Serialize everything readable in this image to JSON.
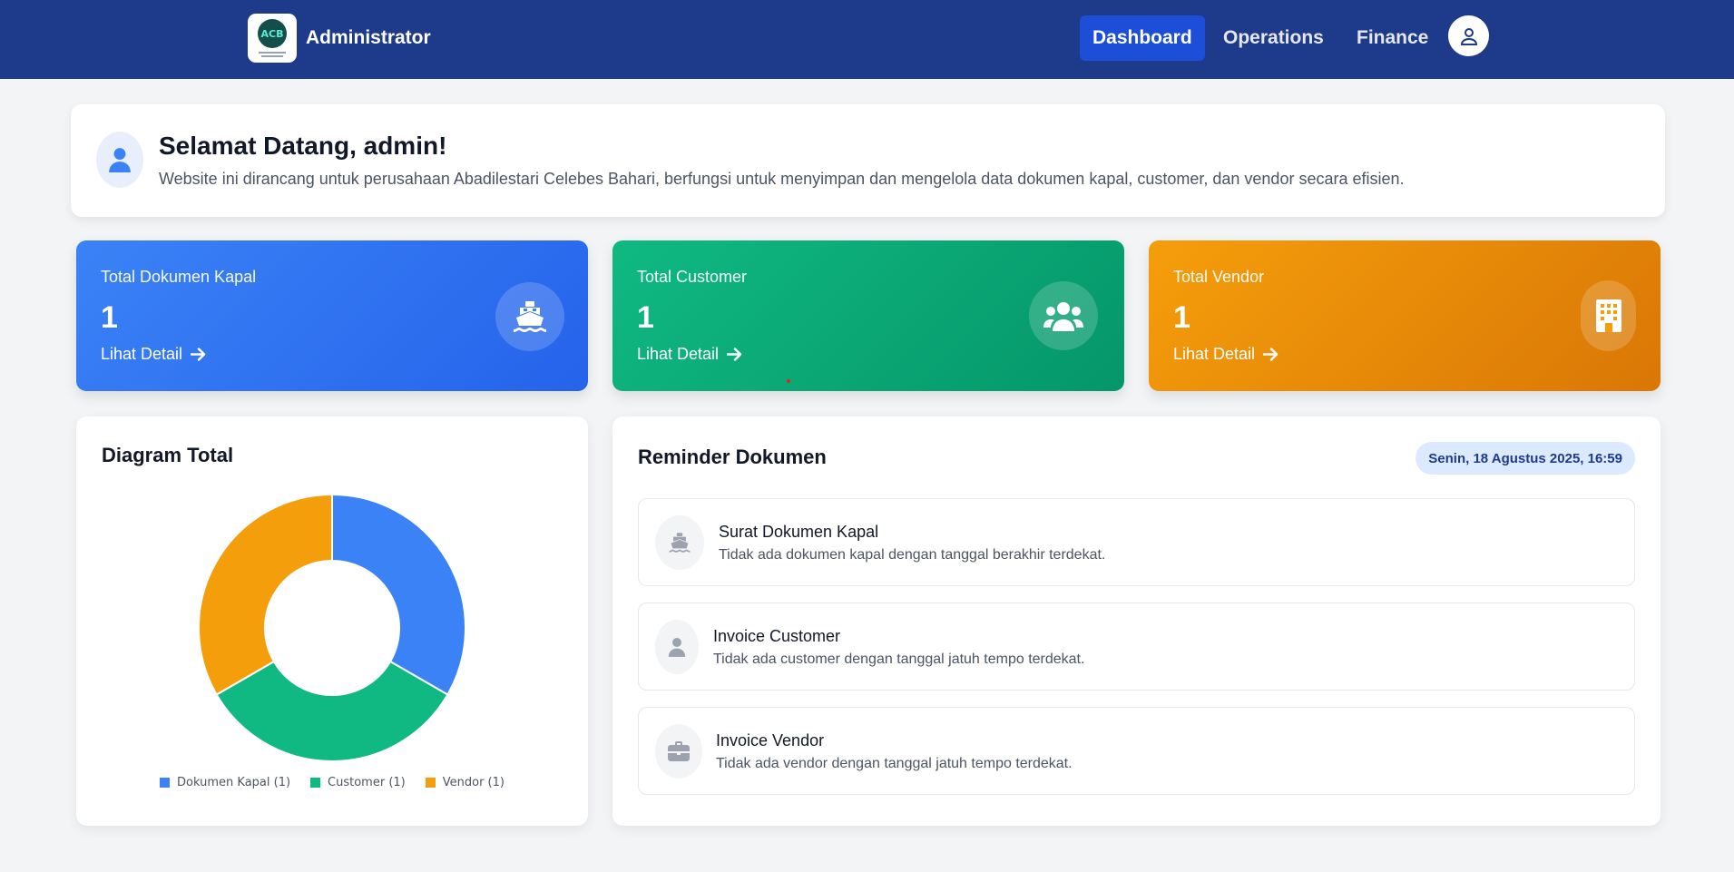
{
  "navbar": {
    "logo_text": "ACB",
    "brand": "Administrator",
    "items": [
      {
        "label": "Dashboard"
      },
      {
        "label": "Operations"
      },
      {
        "label": "Finance"
      }
    ],
    "user_icon": "user-icon"
  },
  "welcome": {
    "title": "Selamat Datang, admin!",
    "description": "Website ini dirancang untuk perusahaan Abadilestari Celebes Bahari, berfungsi untuk menyimpan dan mengelola data dokumen kapal, customer, dan vendor secara efisien."
  },
  "stats": [
    {
      "label": "Total Dokumen Kapal",
      "value": "1",
      "link": "Lihat Detail",
      "icon": "ship-icon",
      "color": "#3b82f6"
    },
    {
      "label": "Total Customer",
      "value": "1",
      "link": "Lihat Detail",
      "icon": "users-icon",
      "color": "#10b981"
    },
    {
      "label": "Total Vendor",
      "value": "1",
      "link": "Lihat Detail",
      "icon": "building-icon",
      "color": "#f59e0b"
    }
  ],
  "chart_card": {
    "title": "Diagram Total"
  },
  "chart_data": {
    "type": "pie",
    "title": "Diagram Total",
    "categories": [
      "Dokumen Kapal",
      "Customer",
      "Vendor"
    ],
    "values": [
      1,
      1,
      1
    ],
    "legend": [
      "Dokumen Kapal (1)",
      "Customer (1)",
      "Vendor (1)"
    ],
    "colors": [
      "#3b82f6",
      "#10b981",
      "#f59e0b"
    ],
    "donut": true,
    "legend_position": "bottom"
  },
  "reminder": {
    "title": "Reminder Dokumen",
    "date": "Senin, 18 Agustus 2025, 16:59",
    "items": [
      {
        "name": "Surat Dokumen Kapal",
        "message": "Tidak ada dokumen kapal dengan tanggal berakhir terdekat.",
        "icon": "ship-icon"
      },
      {
        "name": "Invoice Customer",
        "message": "Tidak ada customer dengan tanggal jatuh tempo terdekat.",
        "icon": "user-icon"
      },
      {
        "name": "Invoice Vendor",
        "message": "Tidak ada vendor dengan tanggal jatuh tempo terdekat.",
        "icon": "briefcase-icon"
      }
    ]
  }
}
